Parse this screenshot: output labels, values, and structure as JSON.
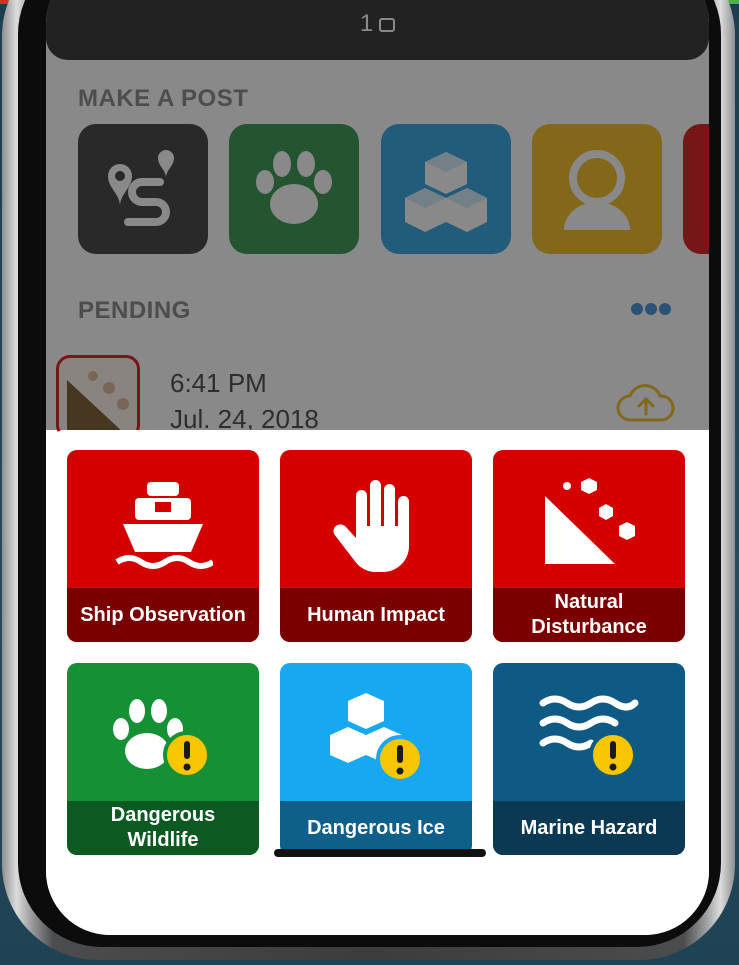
{
  "status_bar": {
    "indicator_text": "1"
  },
  "make_a_post": {
    "label": "MAKE A POST",
    "tiles": [
      {
        "icon": "route-icon",
        "color": "#2a2a2a"
      },
      {
        "icon": "paw-icon",
        "color": "#1f8a3a"
      },
      {
        "icon": "ice-cubes-icon",
        "color": "#1e9be0"
      },
      {
        "icon": "person-icon",
        "color": "#f2b70e"
      },
      {
        "icon": "partial-red-icon",
        "color": "#d40000"
      }
    ]
  },
  "pending": {
    "label": "PENDING",
    "item": {
      "time": "6:41 PM",
      "date": "Jul. 24, 2018"
    }
  },
  "categories": [
    {
      "label": "Ship Observation",
      "icon": "ship-icon",
      "color": "#d40000"
    },
    {
      "label": "Human Impact",
      "icon": "hand-icon",
      "color": "#d40000"
    },
    {
      "label": "Natural Disturbance",
      "icon": "landslide-icon",
      "color": "#d40000"
    },
    {
      "label": "Dangerous Wildlife",
      "icon": "paw-warning-icon",
      "color": "#159035"
    },
    {
      "label": "Dangerous Ice",
      "icon": "ice-warning-icon",
      "color": "#16a8f0"
    },
    {
      "label": "Marine Hazard",
      "icon": "waves-warning-icon",
      "color": "#0f5a85"
    }
  ]
}
